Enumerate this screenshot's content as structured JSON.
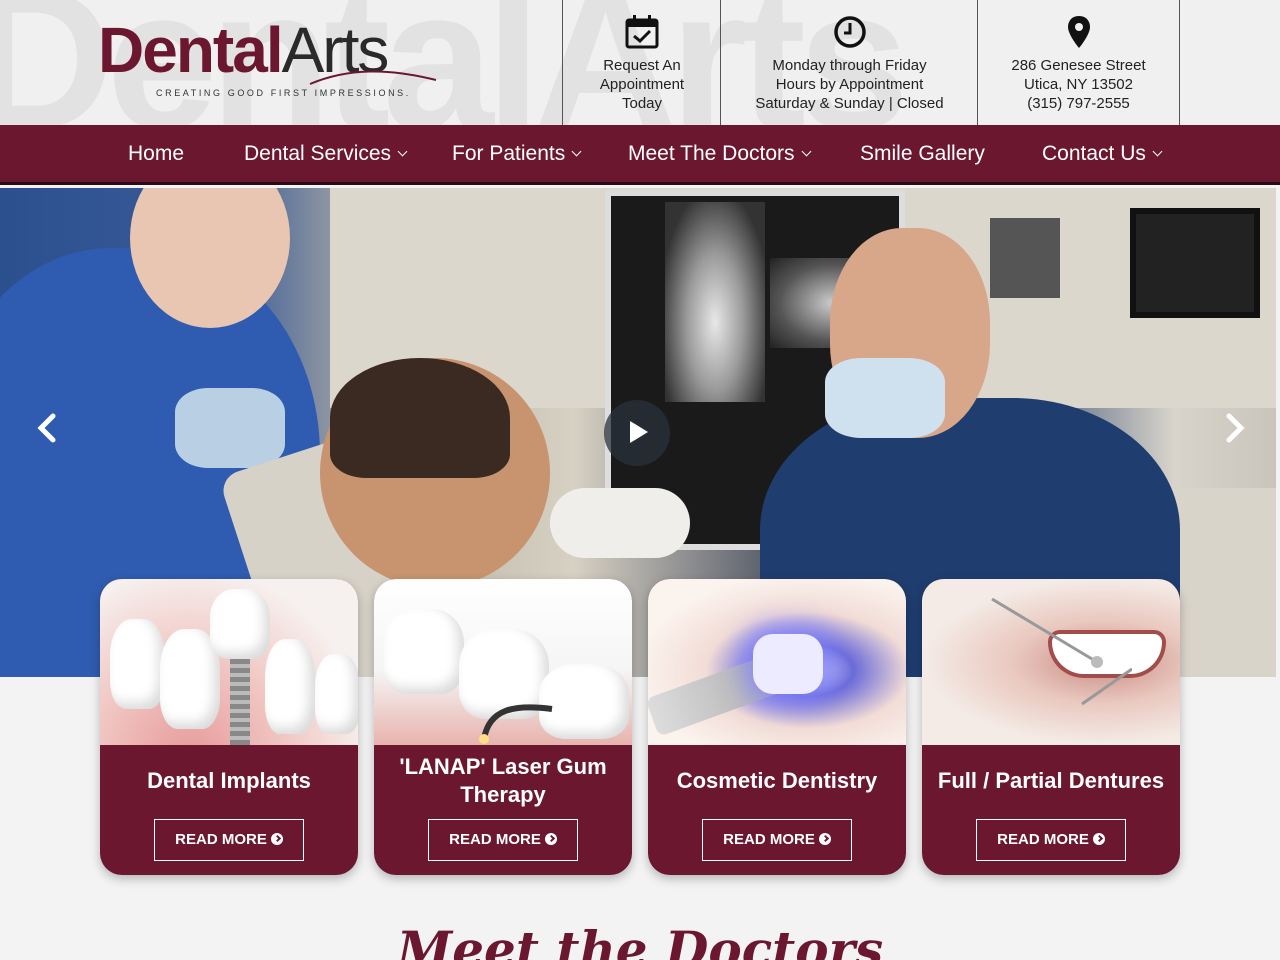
{
  "header": {
    "logo": {
      "brand_bold": "Dental",
      "brand_light": "Arts",
      "tagline": "CREATING GOOD FIRST IMPRESSIONS."
    },
    "watermark": "DentalArts",
    "appointment": {
      "icon": "calendar-check-icon",
      "lines": [
        "Request An",
        "Appointment",
        "Today"
      ]
    },
    "hours": {
      "icon": "clock-icon",
      "lines": [
        "Monday through Friday",
        "Hours by Appointment",
        "Saturday & Sunday | Closed"
      ]
    },
    "address": {
      "icon": "map-pin-icon",
      "lines": [
        "286 Genesee Street",
        "Utica, NY 13502",
        "(315) 797-2555"
      ]
    }
  },
  "nav": {
    "items": [
      {
        "label": "Home",
        "dropdown": false
      },
      {
        "label": "Dental Services",
        "dropdown": true
      },
      {
        "label": "For Patients",
        "dropdown": true
      },
      {
        "label": "Meet The Doctors",
        "dropdown": true
      },
      {
        "label": "Smile Gallery",
        "dropdown": false
      },
      {
        "label": "Contact Us",
        "dropdown": true
      }
    ]
  },
  "hero": {
    "prev_icon": "chevron-left-icon",
    "next_icon": "chevron-right-icon",
    "play_icon": "play-icon"
  },
  "services": [
    {
      "title": "Dental Implants",
      "button": "READ MORE"
    },
    {
      "title": "'LANAP' Laser Gum Therapy",
      "button": "READ MORE"
    },
    {
      "title": "Cosmetic Dentistry",
      "button": "READ MORE"
    },
    {
      "title": "Full / Partial Dentures",
      "button": "READ MORE"
    }
  ],
  "doctors_section": {
    "heading": "Meet the Doctors"
  },
  "colors": {
    "brand": "#6b1730",
    "nav_text": "#ffffff",
    "header_bg": "#f0f0f0"
  }
}
